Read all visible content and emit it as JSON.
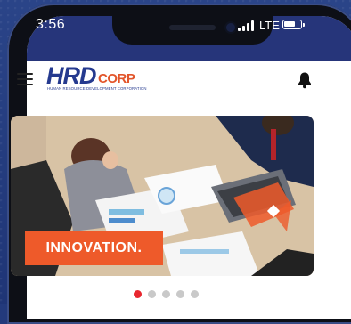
{
  "statusbar": {
    "time": "3:56",
    "network": "LTE"
  },
  "header": {
    "logo": {
      "wordmark": "HRD",
      "suffix": "CORP",
      "tagline": "HUMAN RESOURCE DEVELOPMENT CORPORATION"
    },
    "menu_icon": "hamburger-menu-icon",
    "notification_icon": "bell-icon"
  },
  "carousel": {
    "slides_total": 5,
    "active_index": 0,
    "current_slide": {
      "caption": "INNOVATION."
    }
  },
  "colors": {
    "brand_blue": "#253a8f",
    "brand_orange": "#ee5a2a",
    "dot_active": "#e8272f",
    "dot_inactive": "#c9c9c9"
  }
}
